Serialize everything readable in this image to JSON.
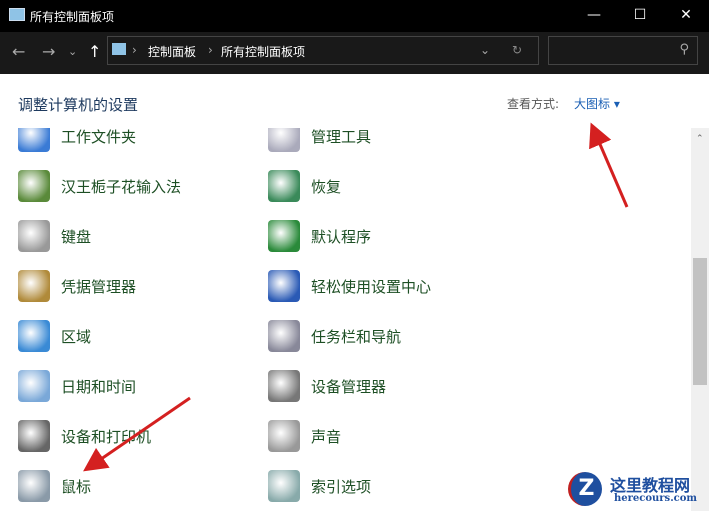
{
  "window": {
    "title": "所有控制面板项",
    "minimize": "—",
    "maximize": "☐",
    "close": "✕"
  },
  "address": {
    "back": "←",
    "forward": "→",
    "recent": "⌄",
    "up": "↑",
    "path": [
      "控制面板",
      "所有控制面板项"
    ],
    "separator": "›",
    "dropdown": "⌄",
    "refresh": "↻",
    "search_placeholder": "",
    "search_icon": "⚲"
  },
  "content": {
    "heading": "调整计算机的设置",
    "view_label": "查看方式:",
    "view_value": "大图标 ▾"
  },
  "items_left": [
    {
      "label": "工作文件夹",
      "color": "#3a7bd5"
    },
    {
      "label": "汉王栀子花输入法",
      "color": "#5a8a3a"
    },
    {
      "label": "键盘",
      "color": "#999"
    },
    {
      "label": "凭据管理器",
      "color": "#b08a3a"
    },
    {
      "label": "区域",
      "color": "#3a8ad5"
    },
    {
      "label": "日期和时间",
      "color": "#7aa8d8"
    },
    {
      "label": "设备和打印机",
      "color": "#666"
    },
    {
      "label": "鼠标",
      "color": "#8a9aa8"
    }
  ],
  "items_right": [
    {
      "label": "管理工具",
      "color": "#aab"
    },
    {
      "label": "恢复",
      "color": "#3a8a5a"
    },
    {
      "label": "默认程序",
      "color": "#2a8a3a"
    },
    {
      "label": "轻松使用设置中心",
      "color": "#2a5ab5"
    },
    {
      "label": "任务栏和导航",
      "color": "#889"
    },
    {
      "label": "设备管理器",
      "color": "#777"
    },
    {
      "label": "声音",
      "color": "#999"
    },
    {
      "label": "索引选项",
      "color": "#8aa"
    }
  ],
  "watermark": {
    "name": "这里教程网",
    "url": "herecours.com"
  }
}
